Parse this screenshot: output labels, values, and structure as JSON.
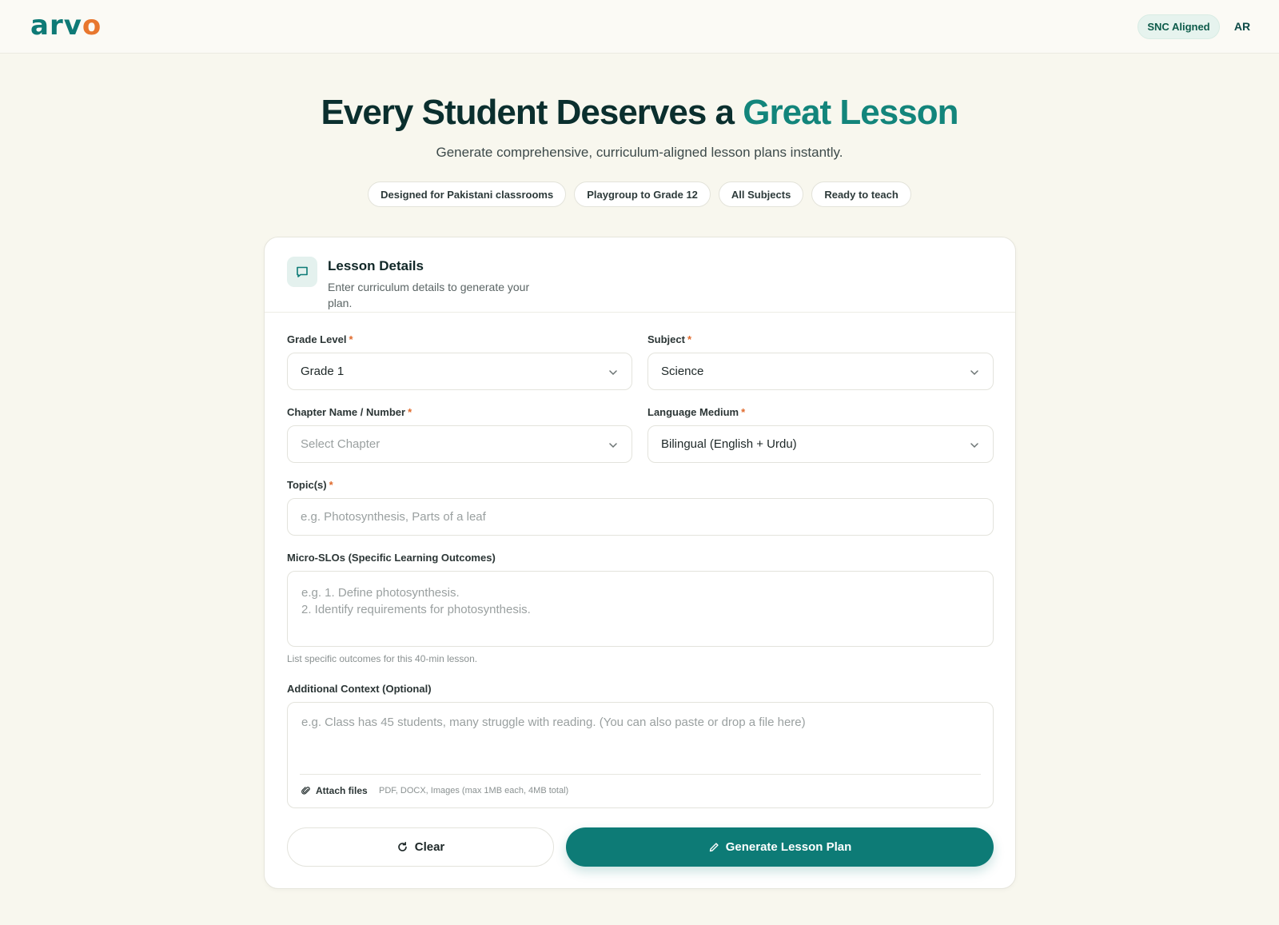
{
  "header": {
    "logo_text": "arv",
    "logo_accent": "o",
    "badge": "SNC Aligned",
    "lang_toggle": "AR"
  },
  "hero": {
    "title_main": "Every Student Deserves a ",
    "title_highlight": "Great Lesson",
    "subtitle": "Generate comprehensive, curriculum-aligned lesson plans instantly.",
    "pills": [
      "Designed for Pakistani classrooms",
      "Playgroup to Grade 12",
      "All Subjects",
      "Ready to teach"
    ]
  },
  "card": {
    "icon": "book-icon",
    "title": "Lesson Details",
    "description": "Enter curriculum details to generate your plan."
  },
  "form": {
    "required_mark": "*",
    "grade": {
      "label": "Grade Level",
      "value": "Grade 1"
    },
    "subject": {
      "label": "Subject",
      "value": "Science"
    },
    "chapter": {
      "label": "Chapter Name / Number",
      "placeholder": "Select Chapter"
    },
    "language": {
      "label": "Language Medium",
      "value": "Bilingual (English + Urdu)"
    },
    "topics": {
      "label": "Topic(s)",
      "placeholder": "e.g. Photosynthesis, Parts of a leaf"
    },
    "slos": {
      "label": "Micro-SLOs (Specific Learning Outcomes)",
      "placeholder": "e.g. 1. Define photosynthesis.\n2. Identify requirements for photosynthesis.",
      "hint": "List specific outcomes for this 40-min lesson."
    },
    "context": {
      "label": "Additional Context (Optional)",
      "placeholder": "e.g. Class has 45 students, many struggle with reading. (You can also paste or drop a file here)",
      "attach_label": "Attach files",
      "attach_note": "PDF, DOCX, Images (max 1MB each, 4MB total)"
    }
  },
  "actions": {
    "clear_label": "Clear",
    "generate_label": "Generate Lesson Plan"
  },
  "colors": {
    "brand": "#0d7b76",
    "accent": "#e8772e",
    "background": "#f8f7ee"
  }
}
